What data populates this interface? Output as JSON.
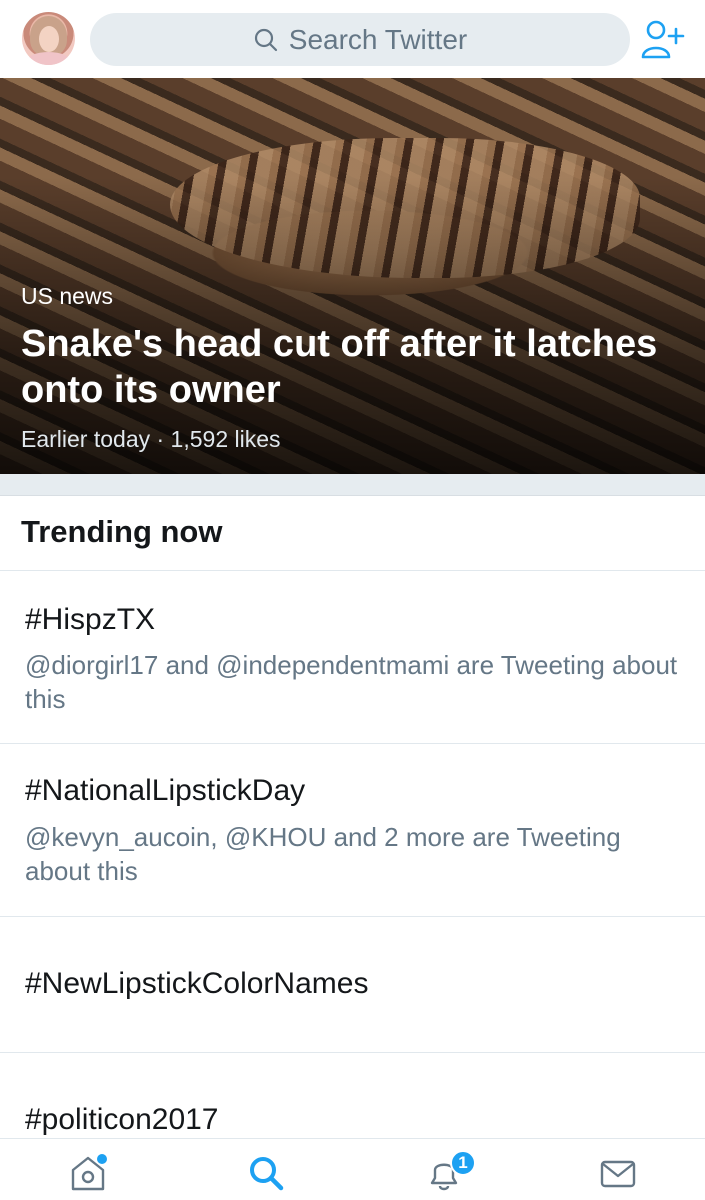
{
  "search": {
    "placeholder": "Search Twitter"
  },
  "hero": {
    "category": "US news",
    "headline": "Snake's head cut off after it latches onto its owner",
    "meta": "Earlier today · 1,592 likes"
  },
  "trending": {
    "title": "Trending now",
    "items": [
      {
        "tag": "#HispzTX",
        "desc": "@diorgirl17 and @independentmami are Tweeting about this"
      },
      {
        "tag": "#NationalLipstickDay",
        "desc": "@kevyn_aucoin, @KHOU and 2 more are Tweeting about this"
      },
      {
        "tag": "#NewLipstickColorNames",
        "desc": ""
      },
      {
        "tag": "#politicon2017",
        "desc": ""
      }
    ]
  },
  "nav": {
    "notifications_badge": "1",
    "icons": [
      "home-icon",
      "search-icon",
      "bell-icon",
      "mail-icon"
    ]
  },
  "colors": {
    "accent": "#1da1f2",
    "secondary_text": "#657786",
    "search_bg": "#e6ecf0"
  }
}
